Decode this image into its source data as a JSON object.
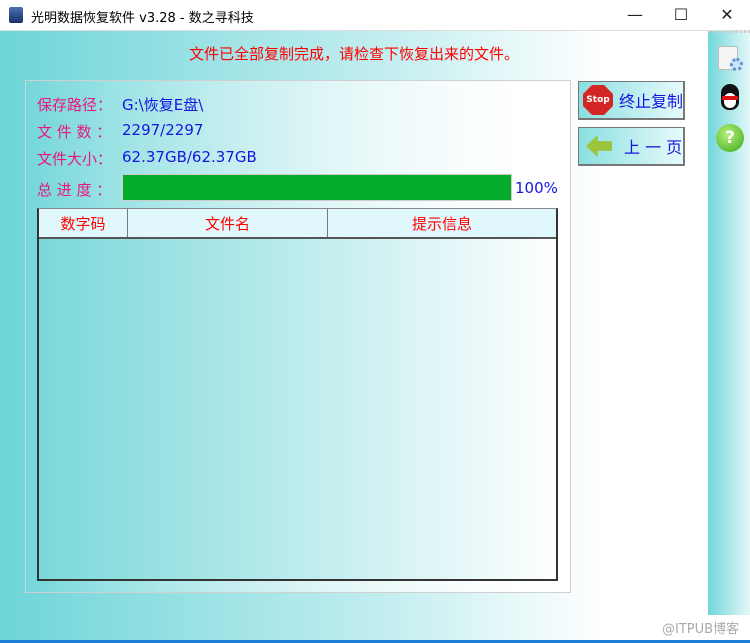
{
  "window": {
    "title": "光明数据恢复软件 v3.28 - 数之寻科技",
    "minimize": "—",
    "maximize": "☐",
    "close": "✕"
  },
  "message": "文件已全部复制完成，请检查下恢复出来的文件。",
  "info": {
    "save_path_label": "保存路径：",
    "save_path": "G:\\恢复E盘\\",
    "file_count_label": "文 件 数 ：",
    "file_count": "2297/2297",
    "file_size_label": "文件大小：",
    "file_size": "62.37GB/62.37GB",
    "progress_label": "总 进 度 ：",
    "progress_percent": 100,
    "progress_text": "100%"
  },
  "table": {
    "columns": [
      "数字码",
      "文件名",
      "提示信息"
    ],
    "rows": []
  },
  "buttons": {
    "stop_copy": "终止复制",
    "stop_icon_text": "Stop",
    "previous_page": "上 一 页"
  },
  "sidebar": {
    "icons": [
      "settings-icon",
      "qq-penguin-icon",
      "help-icon"
    ],
    "help_glyph": "?"
  },
  "watermark": "@ITPUB博客"
}
